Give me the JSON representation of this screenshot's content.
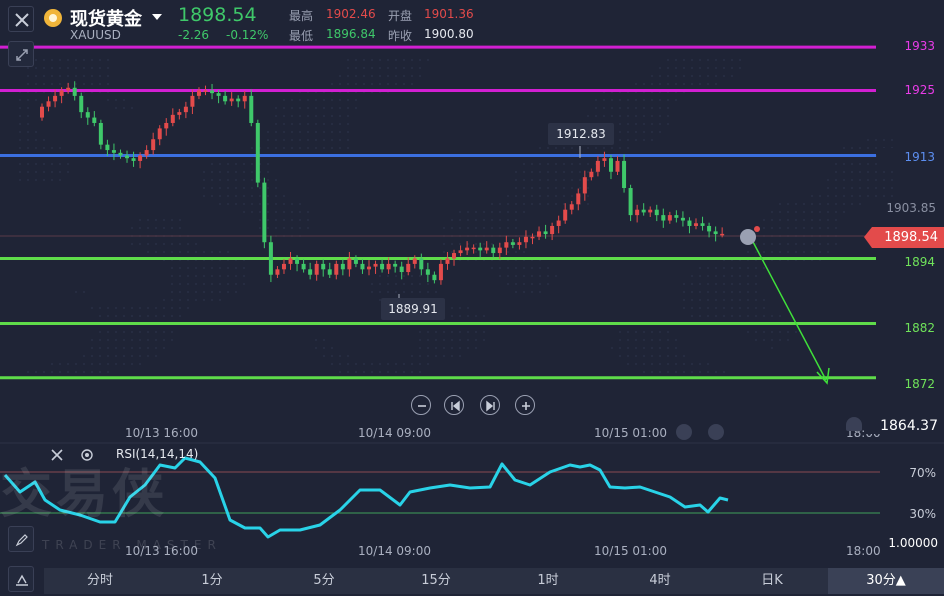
{
  "header": {
    "title": "现货黄金",
    "symbol": "XAUUSD",
    "price": "1898.54",
    "change": "-2.26",
    "change_pct": "-0.12%",
    "stats": {
      "high_label": "最高",
      "high_value": "1902.46",
      "open_label": "开盘",
      "open_value": "1901.36",
      "low_label": "最低",
      "low_value": "1896.84",
      "prev_label": "昨收",
      "prev_value": "1900.80"
    }
  },
  "levels": {
    "l1933": "1933",
    "l1925": "1925",
    "l1913": "1913",
    "l1894": "1894",
    "l1882": "1882",
    "l1872": "1872"
  },
  "price_axis": {
    "mid_label": "1903.85",
    "current_price": "1898.54",
    "bottom_label": "1864.37"
  },
  "callouts": {
    "high": "1912.83",
    "low": "1889.91"
  },
  "time_axis": {
    "main": [
      "10/13 16:00",
      "10/14 09:00",
      "10/15 01:00",
      "18:00"
    ],
    "rsi": [
      "10/13 16:00",
      "10/14 09:00",
      "10/15 01:00",
      "18:00"
    ]
  },
  "rsi": {
    "label": "RSI(14,14,14)",
    "level_70": "70%",
    "level_30": "30%",
    "scale_bottom": "1.00000"
  },
  "watermark": {
    "text": "交易侠",
    "sub": "TRADER MASTER"
  },
  "tabs": [
    "分时",
    "1分",
    "5分",
    "15分",
    "1时",
    "4时",
    "日K",
    "30分▲"
  ],
  "colors": {
    "background": "#1f2436",
    "up": "#e34b4b",
    "down": "#3fc86a",
    "magenta": "#d21fd2",
    "blue": "#3b6fe0",
    "green_level": "#5fdc4a",
    "rsi_line": "#29d3e8"
  },
  "icons": [
    "close-icon",
    "gold-coin-icon",
    "dropdown-caret-icon",
    "collapse-icon",
    "zoom-out-icon",
    "prev-icon",
    "next-icon",
    "zoom-in-icon",
    "eye-icon",
    "settings-icon",
    "pencil-icon",
    "drawing-tool-icon",
    "bell-icon",
    "info-icon"
  ]
}
